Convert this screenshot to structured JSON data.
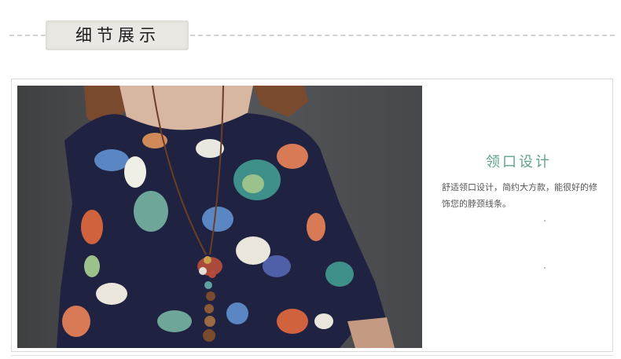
{
  "section_header": {
    "title": "细节展示"
  },
  "feature": {
    "title": "领口设计",
    "description": "舒适领口设计，简约大方款，能很好的修饰您的脖颈线条。"
  },
  "colors": {
    "accent_title": "#5fa38f",
    "dress_navy": "#1f2240",
    "background_wall": "#4c4d4f"
  },
  "photo": {
    "subject": "product-detail-photo"
  }
}
